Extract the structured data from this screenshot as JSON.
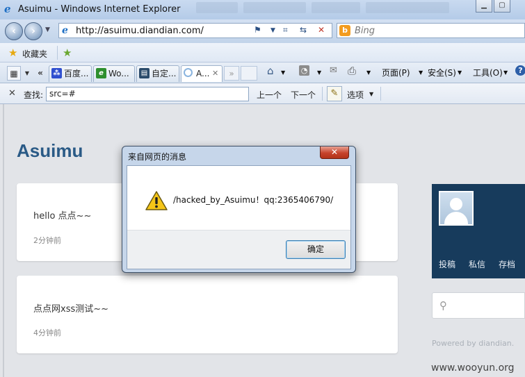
{
  "window": {
    "title": "Asuimu - Windows Internet Explorer",
    "minimize_icon": "minimize-icon",
    "maximize_icon": "maximize-icon"
  },
  "address_bar": {
    "url": "http://asuimu.diandian.com/",
    "search_placeholder": "Bing"
  },
  "favorites_bar": {
    "label": "收藏夹"
  },
  "tabs": [
    {
      "label": "百度...",
      "icon": "baidu-icon",
      "color": "#2f4fcf"
    },
    {
      "label": "Wo...",
      "icon": "ie-icon",
      "color": "#2e8f2e"
    },
    {
      "label": "自定...",
      "icon": "page-icon",
      "color": "#2a4a6a"
    },
    {
      "label": "A...",
      "icon": "loading-icon",
      "color": "#8ab4df"
    }
  ],
  "commands": {
    "page": "页面(P)",
    "safety": "安全(S)",
    "tools": "工具(O)"
  },
  "find_bar": {
    "label": "查找:",
    "value": "src=#",
    "previous": "上一个",
    "next": "下一个",
    "options": "选项"
  },
  "blog": {
    "title": "Asuimu",
    "posts": [
      {
        "text": "hello 点点~~",
        "time": "2分钟前"
      },
      {
        "text": "点点网xss测试~~",
        "time": "4分钟前"
      }
    ],
    "sidebar_links": [
      "投稿",
      "私信",
      "存档"
    ],
    "powered_by": "Powered by diandian.",
    "watermark": "www.wooyun.org"
  },
  "dialog": {
    "title": "来自网页的消息",
    "message": "/hacked_by_Asuimu！qq:2365406790/",
    "ok_label": "确定",
    "close_glyph": "✕"
  },
  "colors": {
    "brand_blue": "#2a5a86",
    "profile_bg": "#173b5c",
    "dialog_frame": "#c6d6ea"
  }
}
